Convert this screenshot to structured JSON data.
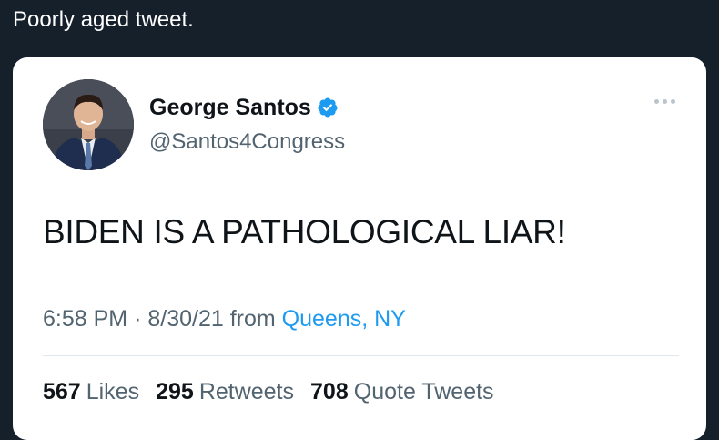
{
  "post": {
    "text": "Poorly aged tweet."
  },
  "tweet": {
    "display_name": "George Santos",
    "handle": "@Santos4Congress",
    "verified_icon": "verified-badge-icon",
    "body": "BIDEN IS A PATHOLOGICAL LIAR!",
    "time": "6:58 PM",
    "separator": "·",
    "date": "8/30/21",
    "from_label": "from",
    "location": "Queens, NY",
    "stats": {
      "likes_count": "567",
      "likes_label": "Likes",
      "retweets_count": "295",
      "retweets_label": "Retweets",
      "quotes_count": "708",
      "quotes_label": "Quote Tweets"
    }
  },
  "colors": {
    "background": "#15202b",
    "card": "#ffffff",
    "link": "#1d9bf0",
    "verified": "#1d9bf0",
    "muted": "#536471"
  }
}
